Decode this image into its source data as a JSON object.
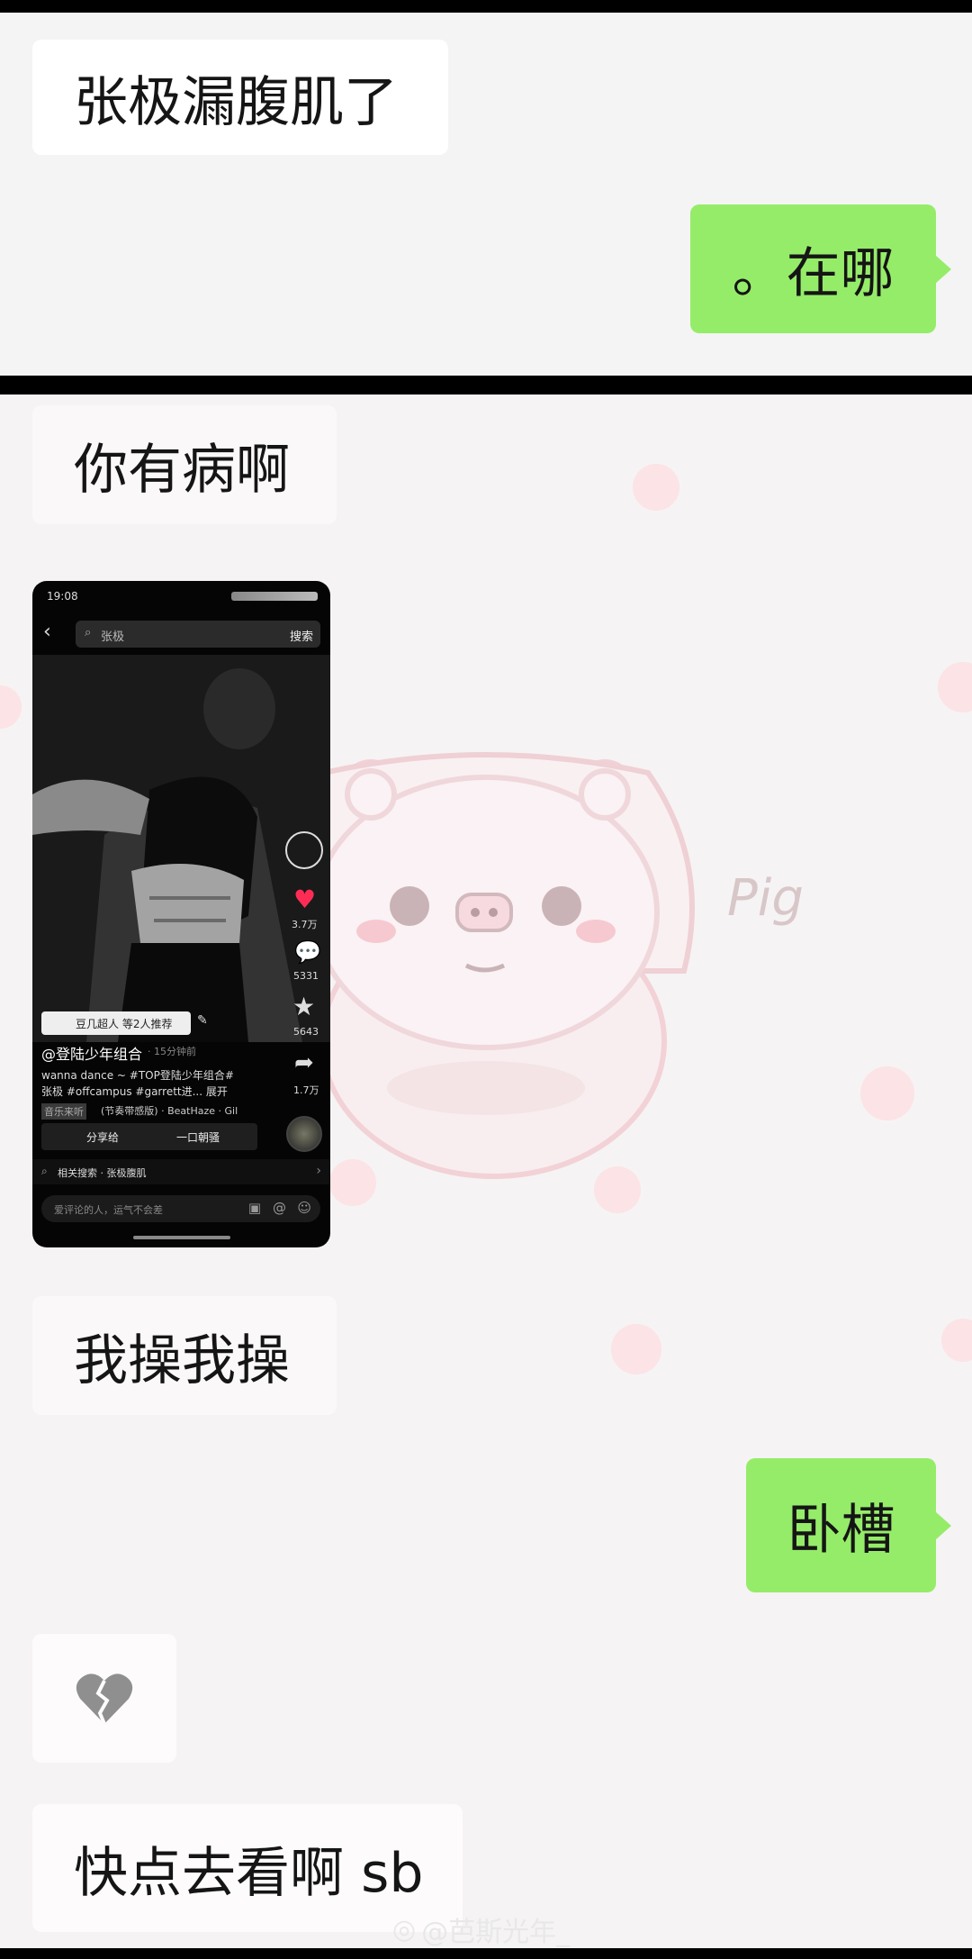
{
  "colors": {
    "sent_bubble": "#95ec69",
    "received_bubble": "#ffffff",
    "chat_bg": "#f4f4f4",
    "divider": "#000000"
  },
  "panel1": {
    "messages": [
      {
        "side": "received",
        "text": "张极漏腹肌了"
      },
      {
        "side": "sent",
        "text": "。在哪"
      }
    ]
  },
  "panel2": {
    "messages": [
      {
        "side": "received",
        "text": "你有病啊"
      },
      {
        "side": "received",
        "type": "image",
        "description_icon": "video-screenshot"
      },
      {
        "side": "received",
        "text": "我操我操"
      },
      {
        "side": "sent",
        "text": "卧槽"
      },
      {
        "side": "received",
        "type": "emoji",
        "icon": "broken-heart-icon"
      },
      {
        "side": "received",
        "text": "快点去看啊 sb"
      }
    ],
    "wallpaper_text": "Pig"
  },
  "screenshot": {
    "status_time": "19:08",
    "search_query": "张极",
    "search_button": "搜索",
    "like_count": "3.7万",
    "comment_count": "5331",
    "star_count": "5643",
    "share_count": "1.7万",
    "recommend_tag": "豆几超人 等2人推荐",
    "author": "@登陆少年组合",
    "post_time": "· 15分钟前",
    "caption_line1": "wanna dance ~ #TOP登陆少年组合#",
    "caption_line2": "张极 #offcampus #garrett进... 展开",
    "music": "(节奏带感版) · BeatHaze · Gil",
    "music_tag": "音乐来听",
    "share_to": "分享给",
    "share_to2": "一口朝骚",
    "related_search": "相关搜索 · 张极腹肌",
    "comment_placeholder": "爱评论的人，运气不会差"
  },
  "watermark": "@芭斯光年_"
}
